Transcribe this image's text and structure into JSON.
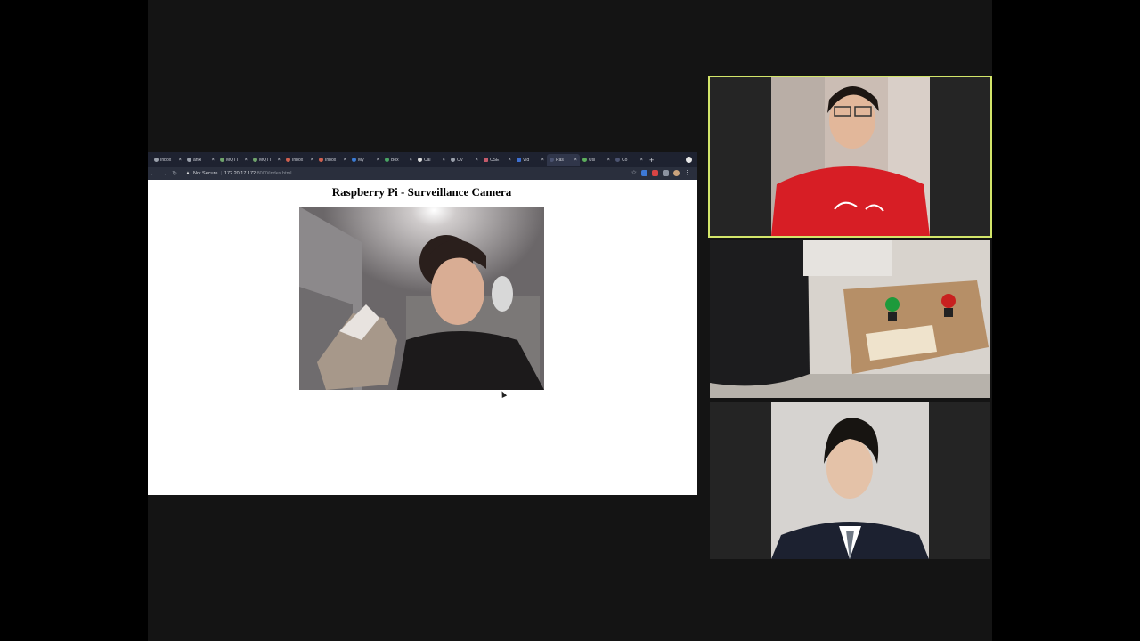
{
  "browser": {
    "tabs": [
      {
        "label": "Inbox",
        "icon": "github-icon"
      },
      {
        "label": "anki",
        "icon": "github-icon"
      },
      {
        "label": "MQTT",
        "icon": "site-icon"
      },
      {
        "label": "MQTT",
        "icon": "site-icon"
      },
      {
        "label": "Inbox",
        "icon": "gmail-icon"
      },
      {
        "label": "Inbox",
        "icon": "gmail-icon"
      },
      {
        "label": "My",
        "icon": "site-icon"
      },
      {
        "label": "Box",
        "icon": "drive-icon"
      },
      {
        "label": "Cal",
        "icon": "site-icon"
      },
      {
        "label": "CV",
        "icon": "github-icon"
      },
      {
        "label": "CSE",
        "icon": "site-icon"
      },
      {
        "label": "Vid",
        "icon": "site-icon"
      },
      {
        "label": "Ras",
        "icon": "site-icon",
        "active": true
      },
      {
        "label": "Usi",
        "icon": "site-icon"
      },
      {
        "label": "Co",
        "icon": "site-icon"
      }
    ],
    "security_label": "Not Secure",
    "url_host": "172.20.17.172",
    "url_path": ":8000/index.html"
  },
  "page": {
    "title": "Raspberry Pi - Surveillance Camera"
  },
  "colors": {
    "active_speaker_border": "#d3e66a",
    "stage_background": "#141414"
  }
}
